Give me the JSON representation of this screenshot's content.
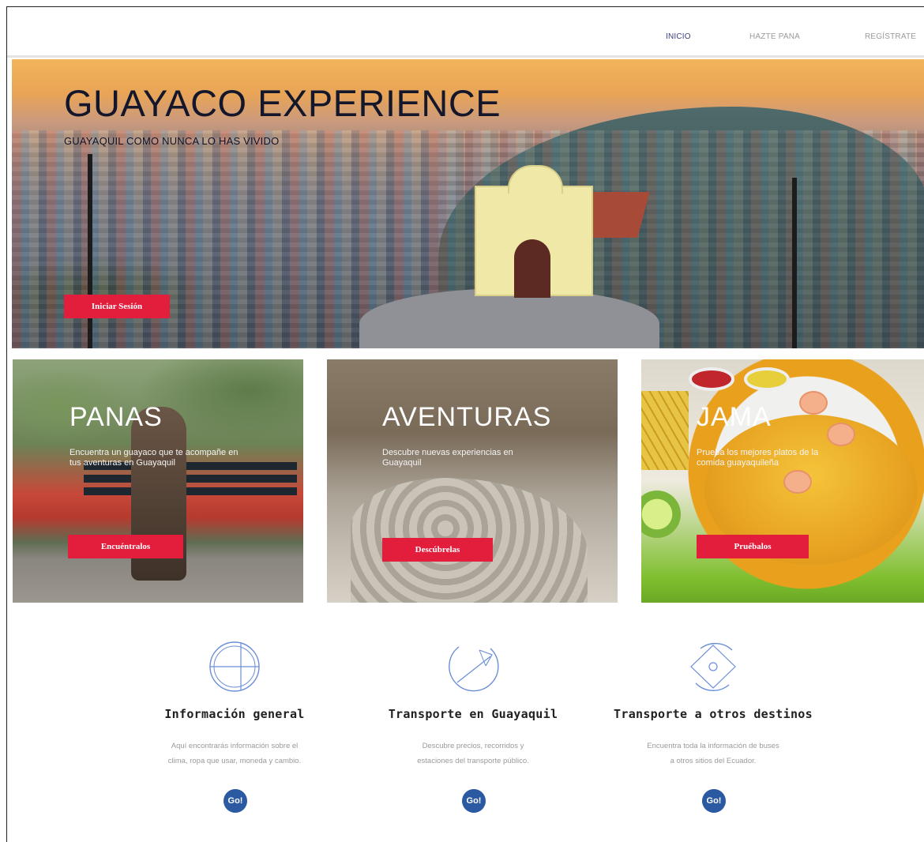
{
  "nav": {
    "items": [
      {
        "label": "INICIO",
        "active": true
      },
      {
        "label": "HAZTE PANA",
        "active": false
      },
      {
        "label": "REGÍSTRATE",
        "active": false
      }
    ]
  },
  "hero": {
    "title": "GUAYACO EXPERIENCE",
    "subtitle": "GUAYAQUIL COMO NUNCA LO HAS VIVIDO",
    "login_button": "Iniciar Sesión"
  },
  "cards": [
    {
      "title": "PANAS",
      "text": "Encuentra un guayaco que te acompañe en tus aventuras en Guayaquil",
      "button": "Encuéntralos"
    },
    {
      "title": "AVENTURAS",
      "text": "Descubre nuevas experiencias en Guayaquil",
      "button": "Descúbrelas"
    },
    {
      "title": "JAMA",
      "text": "Prueba los mejores platos de la comida guayaquileña",
      "button": "Pruébalos"
    }
  ],
  "features": [
    {
      "title": "Información general",
      "text": "Aquí encontrarás información sobre el clima, ropa que usar, moneda y cambio.",
      "icon": "globe-grid-icon",
      "badge": "Go!"
    },
    {
      "title": "Transporte en Guayaquil",
      "text": "Descubre precios, recorridos y estaciones del transporte público.",
      "icon": "compass-arrow-icon",
      "badge": "Go!"
    },
    {
      "title": "Transporte a otros destinos",
      "text": "Encuentra toda la información de buses a otros sitios del Ecuador.",
      "icon": "diamond-target-icon",
      "badge": "Go!"
    }
  ],
  "colors": {
    "accent": "#e31d3c",
    "nav_active": "#3a3f7a",
    "icon_blue": "#6b8fd6",
    "badge": "#2b5aa3"
  }
}
